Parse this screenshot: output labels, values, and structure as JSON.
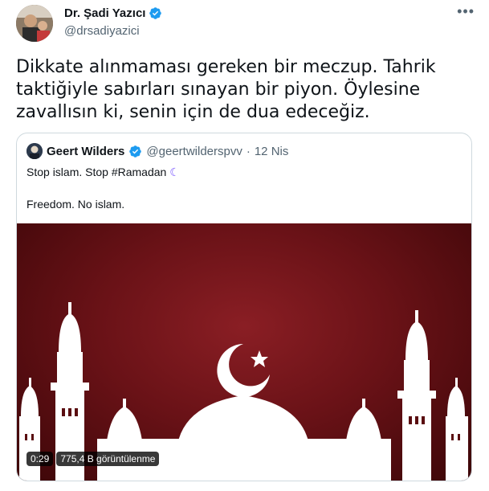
{
  "author": {
    "name": "Dr. Şadi Yazıcı",
    "handle": "@drsadiyazici"
  },
  "more_icon": "more-horizontal-icon",
  "tweet_text": "Dikkate alınmaması gereken bir meczup. Tahrik taktiğiyle sabırları sınayan bir piyon. Öylesine zavallısın ki, senin için de dua edeceğiz.",
  "quoted": {
    "name": "Geert Wilders",
    "handle": "@geertwilderspvv",
    "separator": "·",
    "date": "12 Nis",
    "line1": "Stop islam. Stop #Ramadan",
    "moon_emoji": "☾",
    "line2": "Freedom. No islam."
  },
  "video": {
    "duration": "0:29",
    "views": "775,4 B görüntülenme"
  },
  "colors": {
    "verified": "#1d9bf0",
    "text": "#0f1419",
    "muted": "#536471",
    "border": "#cfd9de"
  }
}
